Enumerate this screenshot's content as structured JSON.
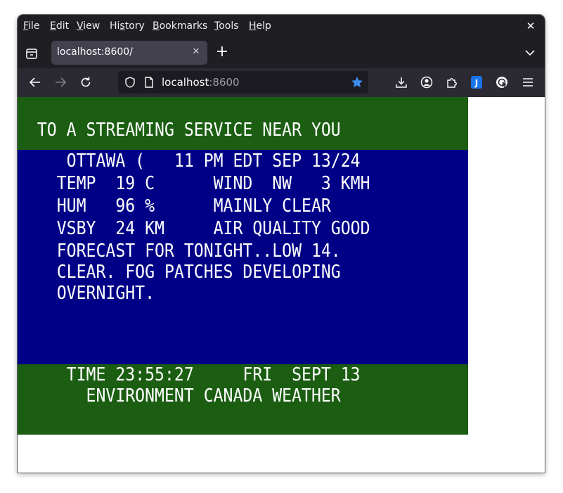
{
  "menu": {
    "items": [
      {
        "acc": "F",
        "rest": "ile"
      },
      {
        "acc": "E",
        "rest": "dit"
      },
      {
        "acc": "V",
        "rest": "iew"
      },
      {
        "pre": "Hi",
        "acc": "s",
        "rest": "tory"
      },
      {
        "acc": "B",
        "rest": "ookmarks"
      },
      {
        "acc": "T",
        "rest": "ools"
      },
      {
        "acc": "H",
        "rest": "elp"
      }
    ]
  },
  "tab": {
    "title": "localhost:8600/"
  },
  "urlbar": {
    "host": "localhost",
    "port": ":8600"
  },
  "colors": {
    "chrome_dark": "#1f1e23",
    "toolbar": "#2b2a33",
    "tv_green": "#1b5e12",
    "tv_blue": "#000087",
    "bookmark_star": "#3b8ef0"
  },
  "weather": {
    "headline": "  TO A STREAMING SERVICE NEAR YOU",
    "lines": [
      "     OTTAWA (   11 PM EDT SEP 13/24",
      "    TEMP  19 C      WIND  NW   3 KMH",
      "    HUM   96 %      MAINLY CLEAR",
      "    VSBY  24 KM     AIR QUALITY GOOD",
      "    FORECAST FOR TONIGHT..LOW 14.",
      "    CLEAR. FOG PATCHES DEVELOPING",
      "    OVERNIGHT."
    ],
    "footer": [
      "     TIME 23:55:27     FRI  SEPT 13",
      "       ENVIRONMENT CANADA WEATHER"
    ]
  }
}
